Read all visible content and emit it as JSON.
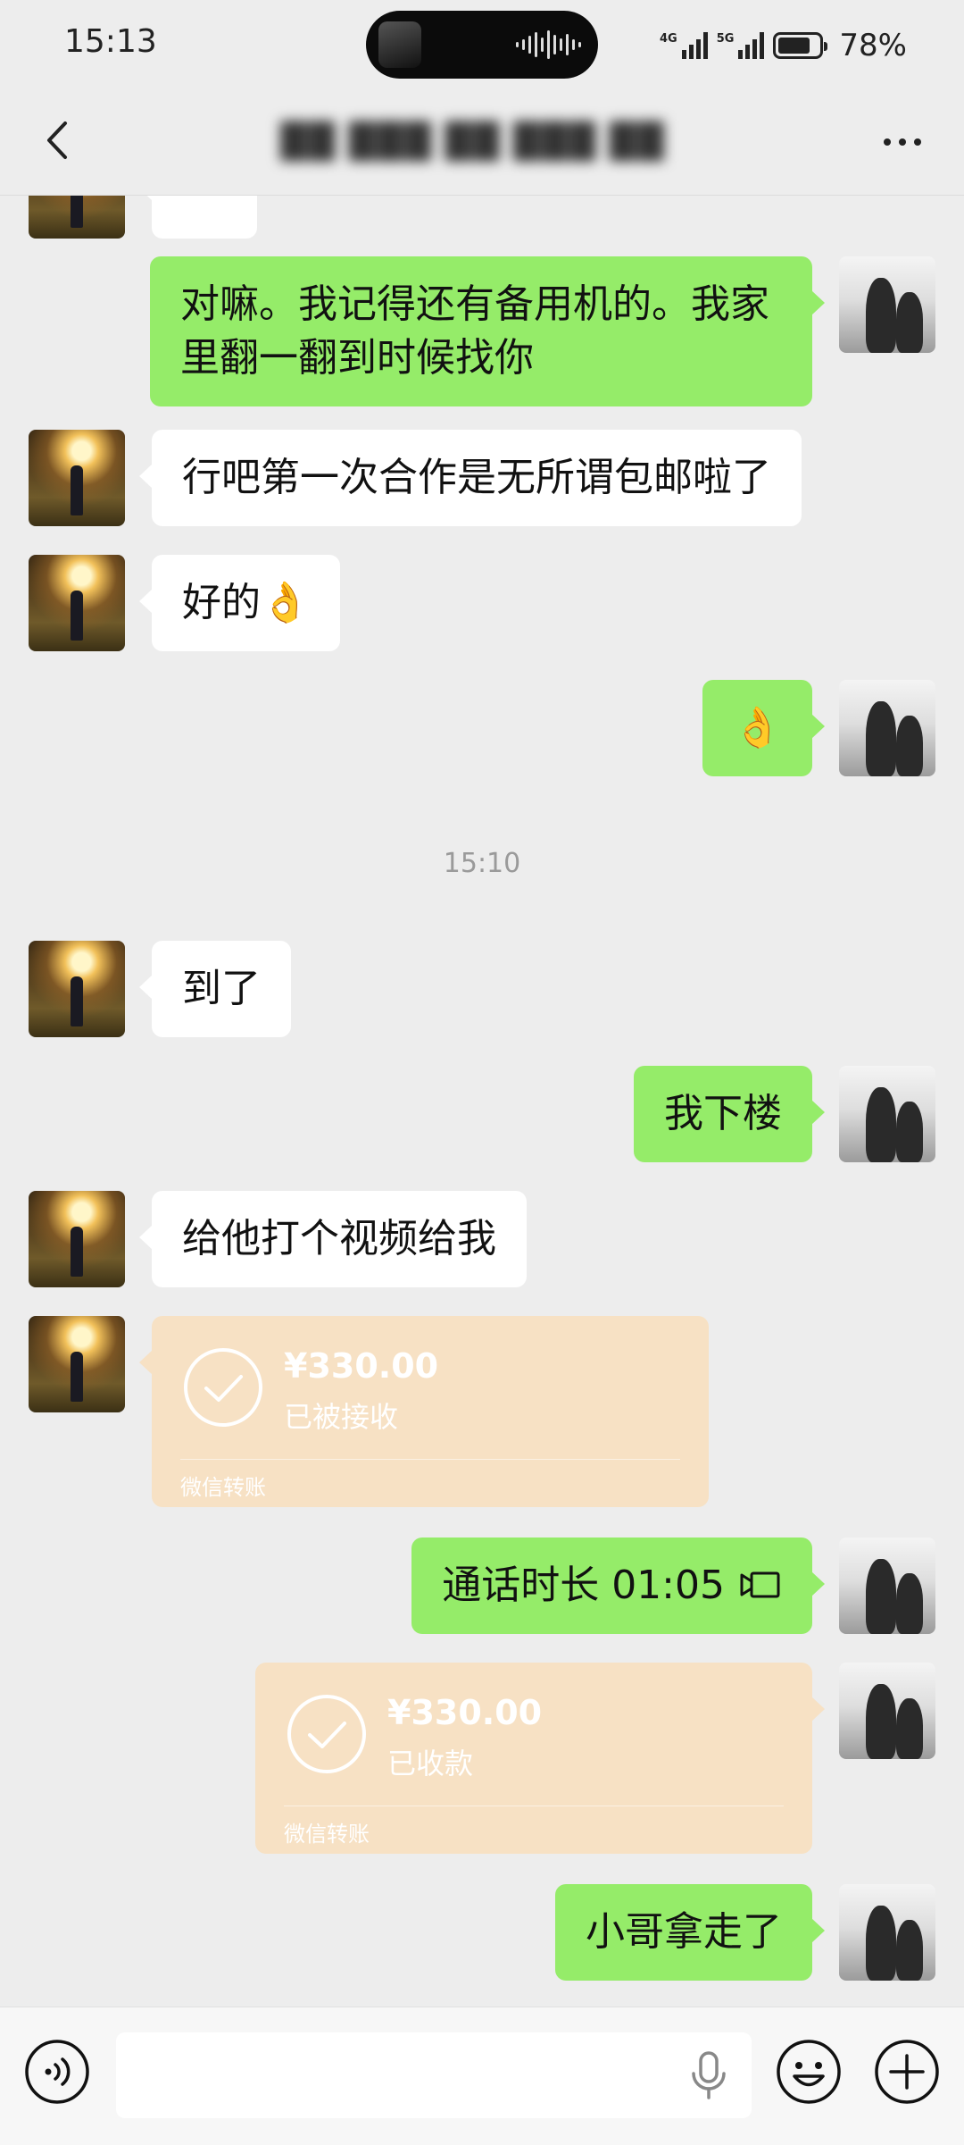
{
  "status_bar": {
    "time": "15:13",
    "network_1": "4G",
    "network_2": "5G",
    "battery_level": 0.78,
    "battery_text": "78%"
  },
  "header": {
    "title": "██ ███ ██ ███ ██"
  },
  "chat": {
    "messages": [
      {
        "from": "me",
        "type": "text",
        "text": "对嘛。我记得还有备用机的。我家里翻一翻到时候找你"
      },
      {
        "from": "other",
        "type": "text",
        "text": "行吧第一次合作是无所谓包邮啦了"
      },
      {
        "from": "other",
        "type": "text",
        "text": "好的",
        "emoji": "👌"
      },
      {
        "from": "me",
        "type": "emoji",
        "text": "👌"
      },
      {
        "type": "timestamp",
        "text": "15:10"
      },
      {
        "from": "other",
        "type": "text",
        "text": "到了"
      },
      {
        "from": "me",
        "type": "text",
        "text": "我下楼"
      },
      {
        "from": "other",
        "type": "text",
        "text": "给他打个视频给我"
      },
      {
        "from": "other",
        "type": "transfer",
        "amount": "¥330.00",
        "status": "已被接收",
        "footer": "微信转账"
      },
      {
        "from": "me",
        "type": "call",
        "text": "通话时长 01:05"
      },
      {
        "from": "me",
        "type": "transfer",
        "amount": "¥330.00",
        "status": "已收款",
        "footer": "微信转账"
      },
      {
        "from": "me",
        "type": "text",
        "text": "小哥拿走了"
      }
    ]
  },
  "input_bar": {
    "value": "",
    "placeholder": ""
  },
  "icons": {
    "back": "chevron-left-icon",
    "more": "more-dots-icon",
    "voice": "voice-mode-icon",
    "mic": "microphone-icon",
    "emoji": "emoji-icon",
    "plus": "plus-icon",
    "call": "video-call-icon",
    "transfer_check": "check-circle-icon"
  },
  "colors": {
    "background": "#ededed",
    "outgoing_bubble": "#95ec69",
    "incoming_bubble": "#ffffff",
    "transfer_card": "#f7e1c4"
  }
}
